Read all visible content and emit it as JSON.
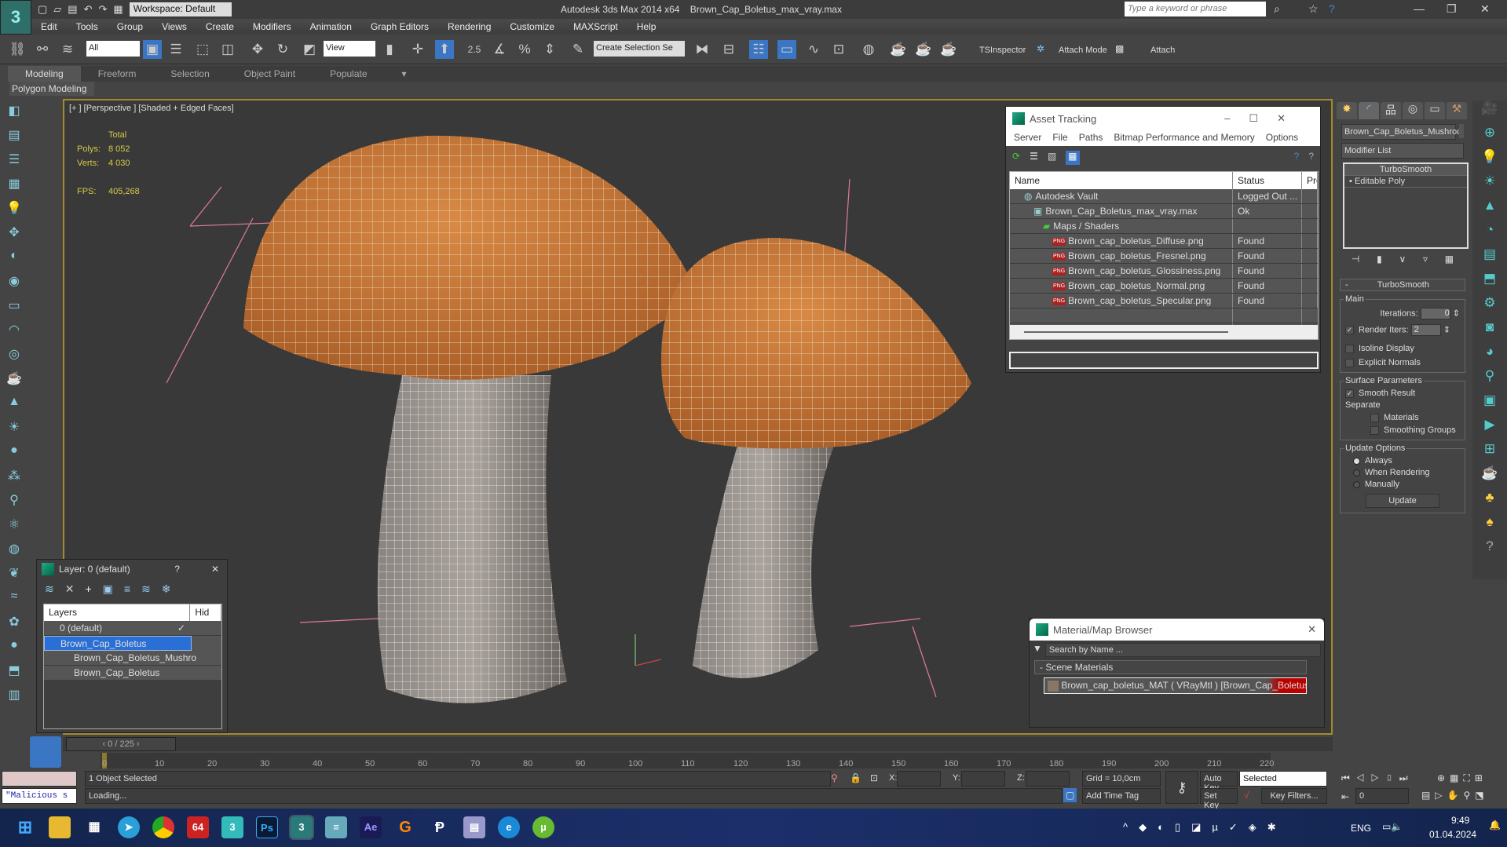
{
  "titlebar": {
    "workspace": "Workspace: Default",
    "app": "Autodesk 3ds Max  2014 x64",
    "file": "Brown_Cap_Boletus_max_vray.max",
    "search_placeholder": "Type a keyword or phrase"
  },
  "menu": [
    "Edit",
    "Tools",
    "Group",
    "Views",
    "Create",
    "Modifiers",
    "Animation",
    "Graph Editors",
    "Rendering",
    "Customize",
    "MAXScript",
    "Help"
  ],
  "toolbar": {
    "filter": "All",
    "ref_coord": "View",
    "snap_angle": "2.5",
    "selection_set": "Create Selection Se",
    "tsinspector": "TSInspector",
    "attach_mode": "Attach Mode",
    "attach": "Attach"
  },
  "ribbon": {
    "tabs": [
      "Modeling",
      "Freeform",
      "Selection",
      "Object Paint",
      "Populate"
    ],
    "active": "Modeling",
    "panel": "Polygon Modeling"
  },
  "viewport": {
    "label": "[+ ] [Perspective ] [Shaded + Edged Faces]",
    "stats": {
      "total": "Total",
      "polys_label": "Polys:",
      "polys": "8 052",
      "verts_label": "Verts:",
      "verts": "4 030",
      "fps_label": "FPS:",
      "fps": "405,268"
    }
  },
  "asset_tracking": {
    "title": "Asset Tracking",
    "menu": [
      "Server",
      "File",
      "Paths",
      "Bitmap Performance and Memory",
      "Options"
    ],
    "columns": [
      "Name",
      "Status",
      "Pro"
    ],
    "rows": [
      {
        "name": "Autodesk Vault",
        "status": "Logged Out ...",
        "indent": 1,
        "icon": "vault"
      },
      {
        "name": "Brown_Cap_Boletus_max_vray.max",
        "status": "Ok",
        "indent": 2,
        "icon": "max"
      },
      {
        "name": "Maps / Shaders",
        "status": "",
        "indent": 3,
        "icon": "maps"
      },
      {
        "name": "Brown_cap_boletus_Diffuse.png",
        "status": "Found",
        "indent": 4,
        "icon": "png"
      },
      {
        "name": "Brown_cap_boletus_Fresnel.png",
        "status": "Found",
        "indent": 4,
        "icon": "png"
      },
      {
        "name": "Brown_cap_boletus_Glossiness.png",
        "status": "Found",
        "indent": 4,
        "icon": "png"
      },
      {
        "name": "Brown_cap_boletus_Normal.png",
        "status": "Found",
        "indent": 4,
        "icon": "png"
      },
      {
        "name": "Brown_cap_boletus_Specular.png",
        "status": "Found",
        "indent": 4,
        "icon": "png"
      }
    ],
    "png_badge": "PNG"
  },
  "layer_panel": {
    "title": "Layer: 0 (default)",
    "help": "?",
    "col_layers": "Layers",
    "col_hide": "Hid",
    "rows": [
      {
        "name": "0 (default)",
        "indent": 1
      },
      {
        "name": "Brown_Cap_Boletus",
        "indent": 1,
        "selected": true
      },
      {
        "name": "Brown_Cap_Boletus_Mushro",
        "indent": 2
      },
      {
        "name": "Brown_Cap_Boletus",
        "indent": 2
      }
    ]
  },
  "material_browser": {
    "title": "Material/Map Browser",
    "search_placeholder": "Search by Name ...",
    "group": "- Scene Materials",
    "item": "Brown_cap_boletus_MAT ( VRayMtl ) [Brown_Cap_Boletus_..."
  },
  "command_panel": {
    "object_name": "Brown_Cap_Boletus_Mushroc",
    "modifier_list": "Modifier List",
    "stack": [
      "TurboSmooth",
      "Editable Poly"
    ],
    "rollout": "TurboSmooth",
    "main": "Main",
    "iterations_label": "Iterations:",
    "iterations": "0",
    "render_iters_label": "Render Iters:",
    "render_iters": "2",
    "render_iters_checked": true,
    "isoline": "Isoline Display",
    "explicit": "Explicit Normals",
    "surface": "Surface Parameters",
    "smooth_result": "Smooth Result",
    "smooth_result_checked": true,
    "separate": "Separate",
    "materials": "Materials",
    "smoothing_groups": "Smoothing Groups",
    "update_options": "Update Options",
    "always": "Always",
    "when_rendering": "When Rendering",
    "manually": "Manually",
    "selected_update": "Always",
    "update_btn": "Update"
  },
  "timeline": {
    "frame": "0 / 225",
    "ticks": [
      "0",
      "10",
      "20",
      "30",
      "40",
      "50",
      "60",
      "70",
      "80",
      "90",
      "100",
      "110",
      "120",
      "130",
      "140",
      "150",
      "160",
      "170",
      "180",
      "190",
      "200",
      "210",
      "220"
    ]
  },
  "status": {
    "selected": "1 Object Selected",
    "loading": "Loading...",
    "script": "\"Malicious s",
    "x": "X:",
    "y": "Y:",
    "z": "Z:",
    "grid": "Grid = 10,0cm",
    "add_time_tag": "Add Time Tag",
    "auto_key": "Auto Key",
    "set_key": "Set Key",
    "key_mode": "Selected",
    "key_filters": "Key Filters...",
    "frame": "0"
  },
  "taskbar": {
    "lang": "ENG",
    "time": "9:49",
    "date": "01.04.2024",
    "apps": [
      "start",
      "explorer",
      "taskview",
      "telegram",
      "chrome",
      "aida64",
      "3dsmax-2023",
      "photoshop",
      "3dsmax",
      "notepad",
      "after-effects",
      "gimp",
      "recorder",
      "save",
      "edge",
      "utorrent"
    ]
  },
  "colors": {
    "accent": "#3a76c4",
    "viewport_border": "#a58a2c",
    "cap": "#c8793a",
    "stats": "#d6c94a"
  }
}
